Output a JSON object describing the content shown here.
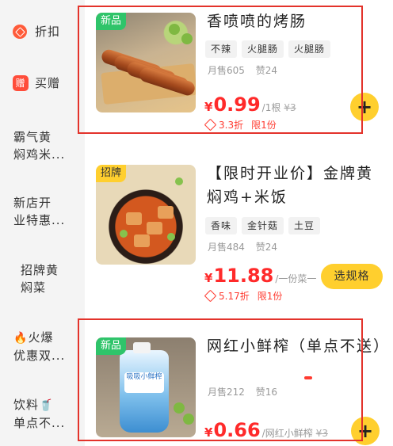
{
  "sidebar": {
    "items": [
      {
        "label": "折扣",
        "icon": "discount-icon"
      },
      {
        "label": "买赠",
        "icon": "gift-badge-icon",
        "icon_text": "赠"
      },
      {
        "line1": "霸气黄",
        "line2": "焖鸡米..."
      },
      {
        "line1": "新店开",
        "line2": "业特惠..."
      },
      {
        "line1": "招牌黄",
        "line2": "焖菜"
      },
      {
        "line1": "火爆",
        "line2": "优惠双...",
        "icon": "fire-icon",
        "icon_glyph": "🔥"
      },
      {
        "line1": "饮料",
        "line2": "单点不...",
        "icon": "drink-cup-icon",
        "icon_glyph": "🥤"
      }
    ]
  },
  "products": [
    {
      "tag": "新品",
      "title": "香喷喷的烤肠",
      "chips": [
        "不辣",
        "火腿肠",
        "火腿肠"
      ],
      "monthly_sales": "月售605",
      "likes": "赞24",
      "price_symbol": "¥",
      "price": "0.99",
      "unit": "/1根",
      "old_price": "¥3",
      "discount": "3.3折",
      "limit": "限1份",
      "add_label": "+"
    },
    {
      "tag": "招牌",
      "title": "【限时开业价】金牌黄焖鸡+米饭",
      "chips": [
        "香味",
        "金针菇",
        "土豆"
      ],
      "monthly_sales": "月售484",
      "likes": "赞24",
      "price_symbol": "¥",
      "price": "11.88",
      "unit": "/一份菜一",
      "discount": "5.17折",
      "limit": "限1份",
      "spec_label": "选规格"
    },
    {
      "tag": "新品",
      "title": "网红小鲜榨（单点不送）",
      "monthly_sales": "月售212",
      "likes": "赞16",
      "price_symbol": "¥",
      "price": "0.66",
      "unit": "/网红小鲜榨",
      "old_price": "¥3",
      "add_label": "+",
      "pouch_text": "吸吸小鲜榨"
    }
  ],
  "colors": {
    "price": "#ff2a2a",
    "accent_yellow": "#ffcf2e",
    "new_tag": "#2fc46a",
    "highlight_border": "#e3332b",
    "sidebar_bg": "#f4f4f4"
  }
}
